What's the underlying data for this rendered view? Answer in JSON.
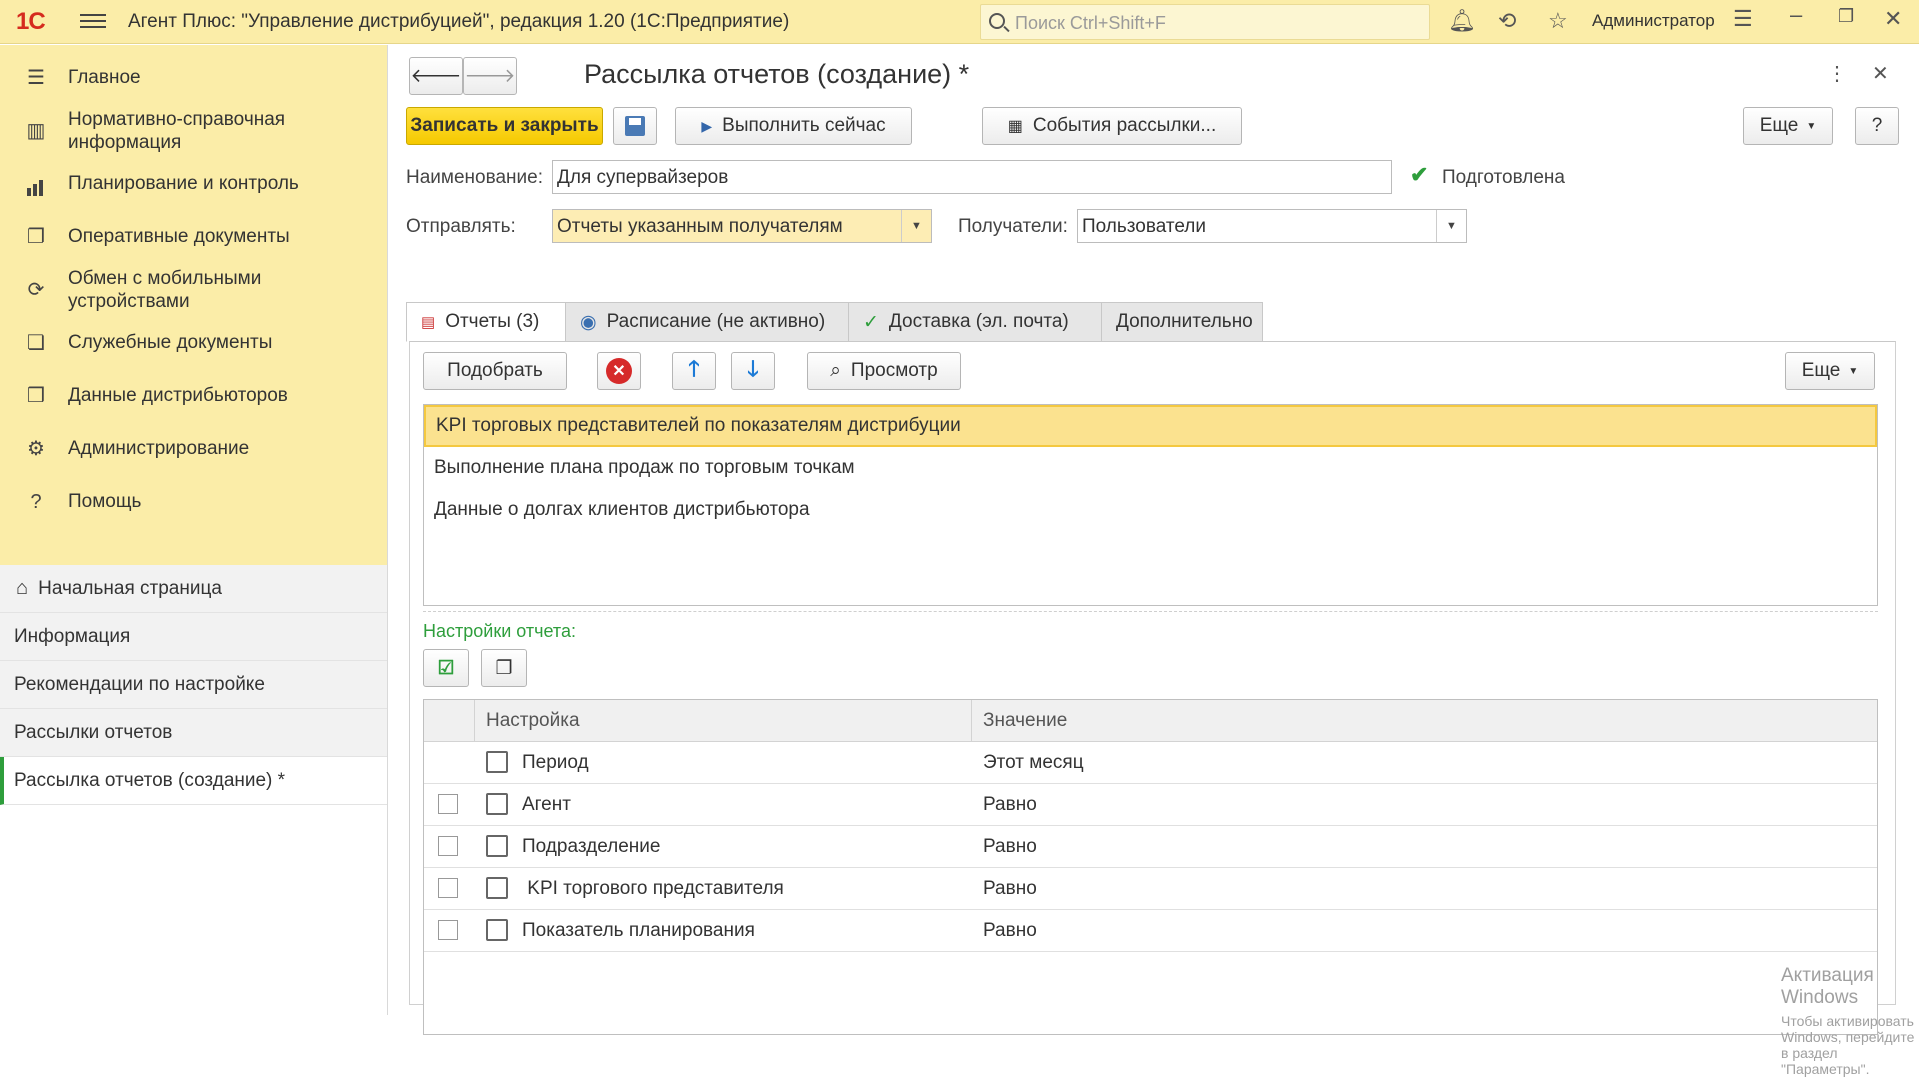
{
  "window": {
    "title": "Агент Плюс: \"Управление дистрибуцией\", редакция 1.20  (1С:Предприятие)",
    "search_placeholder": "Поиск Ctrl+Shift+F",
    "user": "Администратор",
    "logo": "1С"
  },
  "sidebar": {
    "items": [
      {
        "label": "Главное",
        "icon": "menu-icon"
      },
      {
        "label": "Нормативно-справочная информация",
        "icon": "reference-icon"
      },
      {
        "label": "Планирование и контроль",
        "icon": "chart-icon"
      },
      {
        "label": "Оперативные документы",
        "icon": "documents-icon"
      },
      {
        "label": "Обмен с мобильными устройствами",
        "icon": "sync-icon"
      },
      {
        "label": "Служебные документы",
        "icon": "service-docs-icon"
      },
      {
        "label": "Данные дистрибьюторов",
        "icon": "distributor-icon"
      },
      {
        "label": "Администрирование",
        "icon": "gear-icon"
      },
      {
        "label": "Помощь",
        "icon": "question-icon"
      }
    ],
    "open_windows": [
      {
        "label": "Начальная страница"
      },
      {
        "label": "Информация"
      },
      {
        "label": "Рекомендации по настройке"
      },
      {
        "label": "Рассылки отчетов"
      },
      {
        "label": "Рассылка отчетов (создание) *"
      }
    ]
  },
  "form": {
    "title": "Рассылка отчетов (создание) *",
    "save_close_label": "Записать и закрыть",
    "run_now_label": "Выполнить сейчас",
    "events_label": "События рассылки...",
    "more_label": "Еще",
    "help_label": "?",
    "name_label": "Наименование:",
    "name_value": "Для супервайзеров",
    "prepared_label": "Подготовлена",
    "send_label": "Отправлять:",
    "send_value": "Отчеты указанным получателям",
    "recipients_label": "Получатели:",
    "recipients_value": "Пользователи"
  },
  "tabs": [
    {
      "label": "Отчеты (3)"
    },
    {
      "label": "Расписание (не активно)"
    },
    {
      "label": "Доставка (эл. почта)"
    },
    {
      "label": "Дополнительно"
    }
  ],
  "reports_toolbar": {
    "pick_label": "Подобрать",
    "preview_label": "Просмотр",
    "more_label": "Еще"
  },
  "reports": [
    "KPI торговых представителей по показателям дистрибуции",
    "Выполнение плана продаж по торговым точкам",
    "Данные о долгах клиентов дистрибьютора"
  ],
  "settings": {
    "heading": "Настройки отчета:",
    "col_setting": "Настройка",
    "col_value": "Значение",
    "rows": [
      {
        "name": "Период",
        "value": "Этот месяц",
        "checkbox": false
      },
      {
        "name": "Агент",
        "value": "Равно",
        "checkbox": true
      },
      {
        "name": "Подразделение",
        "value": "Равно",
        "checkbox": true
      },
      {
        "name": " KPI торгового представителя",
        "value": "Равно",
        "checkbox": true
      },
      {
        "name": "Показатель планирования",
        "value": "Равно",
        "checkbox": true
      }
    ]
  },
  "watermark": {
    "line1": "Активация Windows",
    "line2": "Чтобы активировать Windows, перейдите в раздел \"Параметры\"."
  },
  "colors": {
    "accent_yellow": "#fbeda8",
    "button_yellow": "#f5c900",
    "green_heading": "#2e9e3c"
  }
}
